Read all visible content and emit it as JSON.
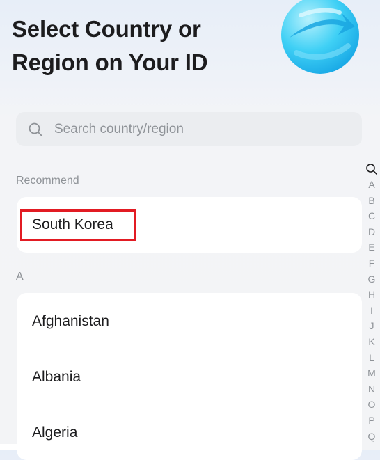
{
  "header": {
    "title": "Select Country or Region on Your ID"
  },
  "search": {
    "placeholder": "Search country/region",
    "icon": "search-icon"
  },
  "sections": {
    "recommend_label": "Recommend",
    "recommend_items": [
      "South Korea"
    ],
    "a_label": "A",
    "a_items": [
      "Afghanistan",
      "Albania",
      "Algeria"
    ]
  },
  "index": {
    "icon": "search-icon",
    "letters": [
      "A",
      "B",
      "C",
      "D",
      "E",
      "F",
      "G",
      "H",
      "I",
      "J",
      "K",
      "L",
      "M",
      "N",
      "O",
      "P",
      "Q"
    ]
  },
  "colors": {
    "highlight": "#e21b23",
    "globe_primary": "#27c3f0",
    "globe_light": "#9be6fb"
  }
}
